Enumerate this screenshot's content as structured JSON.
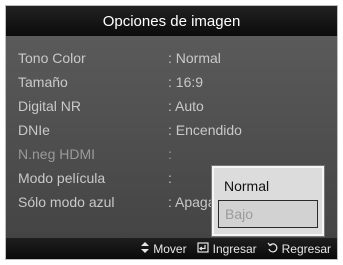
{
  "header": {
    "title": "Opciones de imagen"
  },
  "menu": {
    "items": [
      {
        "label": "Tono Color",
        "value": ": Normal"
      },
      {
        "label": "Tamaño",
        "value": ": 16:9"
      },
      {
        "label": "Digital NR",
        "value": ": Auto"
      },
      {
        "label": "DNIe",
        "value": ": Encendido"
      },
      {
        "label": "N.neg HDMI",
        "value": ":"
      },
      {
        "label": "Modo película",
        "value": ":"
      },
      {
        "label": "Sólo modo azul",
        "value": ": Apagado"
      }
    ]
  },
  "popup": {
    "options": [
      {
        "label": "Normal"
      },
      {
        "label": "Bajo"
      }
    ]
  },
  "footer": {
    "move_icon": "updown-arrows-icon",
    "move_label": "Mover",
    "enter_icon": "enter-icon",
    "enter_label": "Ingresar",
    "return_icon": "return-icon",
    "return_label": "Regresar"
  }
}
